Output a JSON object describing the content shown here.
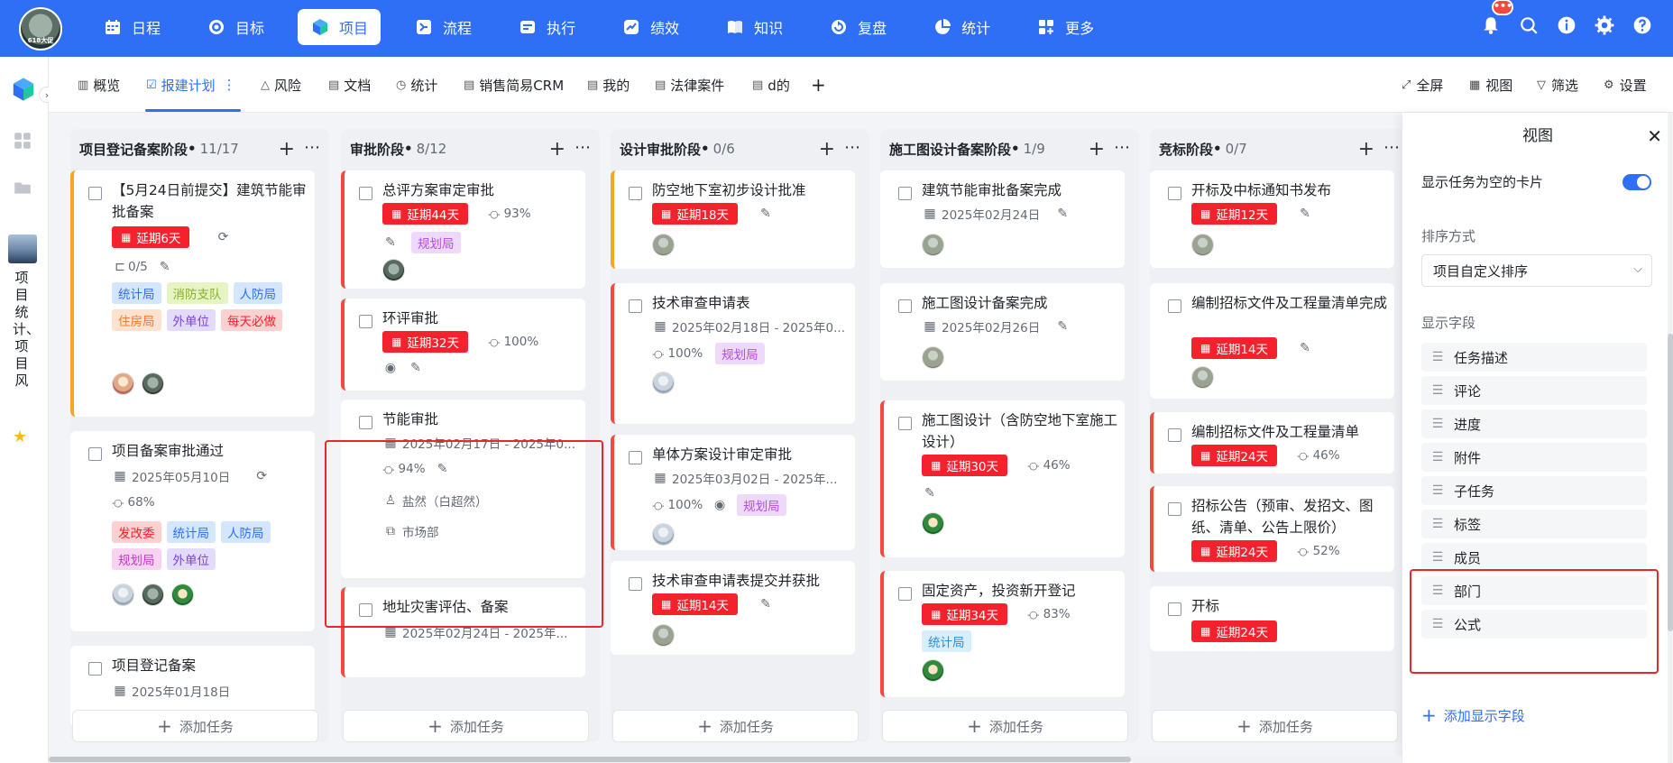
{
  "nav": {
    "logo_text": "618大促",
    "items": [
      {
        "label": "日程",
        "icon": "calendar-icon"
      },
      {
        "label": "目标",
        "icon": "target-icon"
      },
      {
        "label": "项目",
        "icon": "cube-icon"
      },
      {
        "label": "流程",
        "icon": "flow-icon"
      },
      {
        "label": "执行",
        "icon": "execute-icon"
      },
      {
        "label": "绩效",
        "icon": "performance-icon"
      },
      {
        "label": "知识",
        "icon": "book-icon"
      },
      {
        "label": "复盘",
        "icon": "review-icon"
      },
      {
        "label": "统计",
        "icon": "pie-chart-icon"
      },
      {
        "label": "更多",
        "icon": "grid-plus-icon"
      }
    ],
    "active": "项目",
    "notification_badge": "•••"
  },
  "rail": {
    "project_name": "项目统计、项目风"
  },
  "tabs": {
    "items": [
      {
        "label": "概览",
        "icon": "bar-chart-icon"
      },
      {
        "label": "报建计划",
        "icon": "check-square-icon"
      },
      {
        "label": "风险",
        "icon": "warning-icon"
      },
      {
        "label": "文档",
        "icon": "document-icon"
      },
      {
        "label": "统计",
        "icon": "clock-icon"
      },
      {
        "label": "销售简易CRM",
        "icon": "document-icon"
      },
      {
        "label": "我的",
        "icon": "document-icon"
      },
      {
        "label": "法律案件",
        "icon": "document-icon"
      },
      {
        "label": "d的",
        "icon": "document-icon"
      }
    ],
    "active": "报建计划",
    "actions": {
      "fullscreen": "全屏",
      "view": "视图",
      "filter": "筛选",
      "settings": "设置"
    }
  },
  "board": {
    "add_task_label": "添加任务",
    "columns": [
      {
        "title": "项目登记备案阶段",
        "count": "11/17",
        "cards": [
          {
            "title": "【5月24日前提交】建筑节能审批备案",
            "overdue": "延期6天",
            "subtasks": "0/5",
            "tags": [
              [
                "统计局",
                "blue"
              ],
              [
                "消防支队",
                "green"
              ],
              [
                "人防局",
                "blue"
              ],
              [
                "住房局",
                "orange"
              ],
              [
                "外单位",
                "purple"
              ],
              [
                "每天必做",
                "red"
              ]
            ]
          },
          {
            "title": "项目备案审批通过",
            "date": "2025年05月10日",
            "progress": "68%",
            "tags": [
              [
                "发改委",
                "red"
              ],
              [
                "统计局",
                "blue"
              ],
              [
                "人防局",
                "blue"
              ],
              [
                "规划局",
                "pink"
              ],
              [
                "外单位",
                "purple"
              ]
            ]
          },
          {
            "title": "项目登记备案",
            "date": "2025年01月18日"
          }
        ]
      },
      {
        "title": "审批阶段",
        "count": "8/12",
        "cards": [
          {
            "title": "总评方案审定审批",
            "overdue": "延期44天",
            "progress": "93%",
            "tags": [
              [
                "规划局",
                "violet"
              ]
            ]
          },
          {
            "title": "环评审批",
            "overdue": "延期32天",
            "progress": "100%"
          },
          {
            "title": "节能审批",
            "date": "2025年02月17日 - 2025年0...",
            "progress": "94%",
            "member": "盐然（白超然）",
            "department": "市场部"
          },
          {
            "title": "地址灾害评估、备案",
            "date": "2025年02月24日 - 2025年..."
          }
        ]
      },
      {
        "title": "设计审批阶段",
        "count": "0/6",
        "cards": [
          {
            "title": "防空地下室初步设计批准",
            "overdue": "延期18天"
          },
          {
            "title": "技术审查申请表",
            "date": "2025年02月18日 - 2025年0...",
            "progress": "100%",
            "tags": [
              [
                "规划局",
                "violet"
              ]
            ]
          },
          {
            "title": "单体方案设计审定审批",
            "date": "2025年03月02日 - 2025年...",
            "progress": "100%",
            "tags": [
              [
                "规划局",
                "violet"
              ]
            ]
          },
          {
            "title": "技术审查申请表提交并获批",
            "overdue": "延期14天"
          }
        ]
      },
      {
        "title": "施工图设计备案阶段",
        "count": "1/9",
        "cards": [
          {
            "title": "建筑节能审批备案完成",
            "date": "2025年02月24日"
          },
          {
            "title": "施工图设计备案完成",
            "date": "2025年02月26日"
          },
          {
            "title": "施工图设计（含防空地下室施工设计）",
            "overdue": "延期30天",
            "progress": "46%"
          },
          {
            "title": "固定资产，投资新开登记",
            "overdue": "延期34天",
            "progress": "83%",
            "tags": [
              [
                "统计局",
                "cyan"
              ]
            ]
          }
        ]
      },
      {
        "title": "竞标阶段",
        "count": "0/7",
        "cards": [
          {
            "title": "开标及中标通知书发布",
            "overdue": "延期12天"
          },
          {
            "title": "编制招标文件及工程量清单完成",
            "overdue": "延期14天"
          },
          {
            "title": "编制招标文件及工程量清单",
            "overdue": "延期24天",
            "progress": "46%"
          },
          {
            "title": "招标公告（预审、发招文、图纸、清单、公告上限价）",
            "overdue": "延期24天",
            "progress": "52%"
          },
          {
            "title": "开标",
            "overdue": "延期24天"
          }
        ]
      }
    ]
  },
  "view_panel": {
    "title": "视图",
    "show_empty_label": "显示任务为空的卡片",
    "show_empty_enabled": true,
    "sort_label": "排序方式",
    "sort_value": "项目自定义排序",
    "fields_label": "显示字段",
    "fields": [
      "任务描述",
      "评论",
      "进度",
      "附件",
      "子任务",
      "标签",
      "成员",
      "部门",
      "公式"
    ],
    "add_field_label": "添加显示字段"
  },
  "colors": {
    "primary": "#2f6ff5",
    "overdue": "#f5222d",
    "highlight": "#e8262c"
  }
}
